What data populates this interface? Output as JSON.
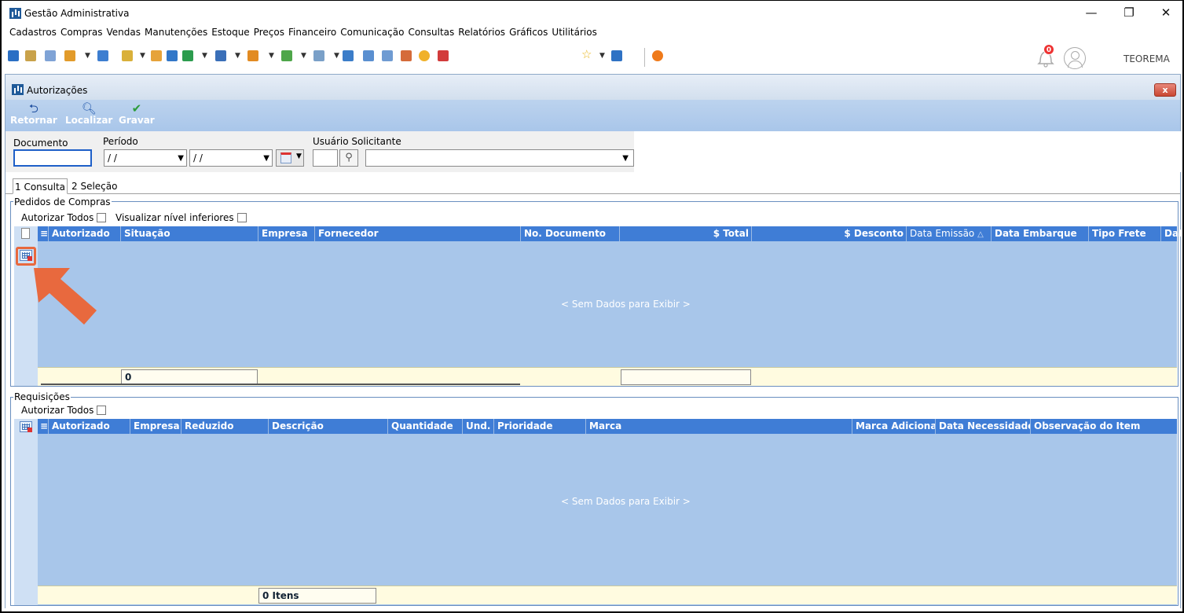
{
  "window": {
    "title": "Gestão Administrativa",
    "minimize": "—",
    "restore": "❐",
    "close": "✕"
  },
  "menu": [
    "Cadastros",
    "Compras",
    "Vendas",
    "Manutenções",
    "Estoque",
    "Preços",
    "Financeiro",
    "Comunicação",
    "Consultas",
    "Relatórios",
    "Gráficos",
    "Utilitários"
  ],
  "header": {
    "notification_count": "0",
    "user": "TEOREMA"
  },
  "form": {
    "title": "Autorizações",
    "close": "x",
    "actions": [
      {
        "label": "Retornar",
        "icon": "return-icon"
      },
      {
        "label": "Localizar",
        "icon": "search-icon"
      },
      {
        "label": "Gravar",
        "icon": "check-icon"
      }
    ]
  },
  "filter": {
    "documento_label": "Documento",
    "periodo_label": "Período",
    "usuario_label": "Usuário Solicitante",
    "periodo_start": "/ /",
    "periodo_end": "/ /",
    "documento_value": "",
    "usuario_code": "",
    "usuario_name": ""
  },
  "tabs": [
    {
      "label": "1 Consulta",
      "active": true
    },
    {
      "label": "2 Seleção",
      "active": false
    }
  ],
  "pedidos": {
    "title": "Pedidos de Compras",
    "autorizar_todos": "Autorizar Todos",
    "visualizar": "Visualizar nível inferiores",
    "columns": [
      "Autorizado",
      "Situação",
      "Empresa",
      "Fornecedor",
      "No. Documento",
      "$ Total",
      "$ Desconto",
      "Data Emissão",
      "Data Embarque",
      "Tipo Frete",
      "Dat"
    ],
    "sort_indicator": "△",
    "empty": "< Sem Dados para Exibir >",
    "footer_count": "0"
  },
  "requisicoes": {
    "title": "Requisições",
    "autorizar_todos": "Autorizar Todos",
    "columns": [
      "Autorizado",
      "Empresa",
      "Reduzido",
      "Descrição",
      "Quantidade",
      "Und.",
      "Prioridade",
      "Marca",
      "Marca Adicional",
      "Data Necessidade",
      "Observação do Item"
    ],
    "empty": "< Sem Dados para Exibir >",
    "footer_count": "0 Itens"
  },
  "colors": {
    "grid_header": "#3f7dd6",
    "grid_body": "#a8c6ea",
    "highlight": "#e8693e"
  }
}
